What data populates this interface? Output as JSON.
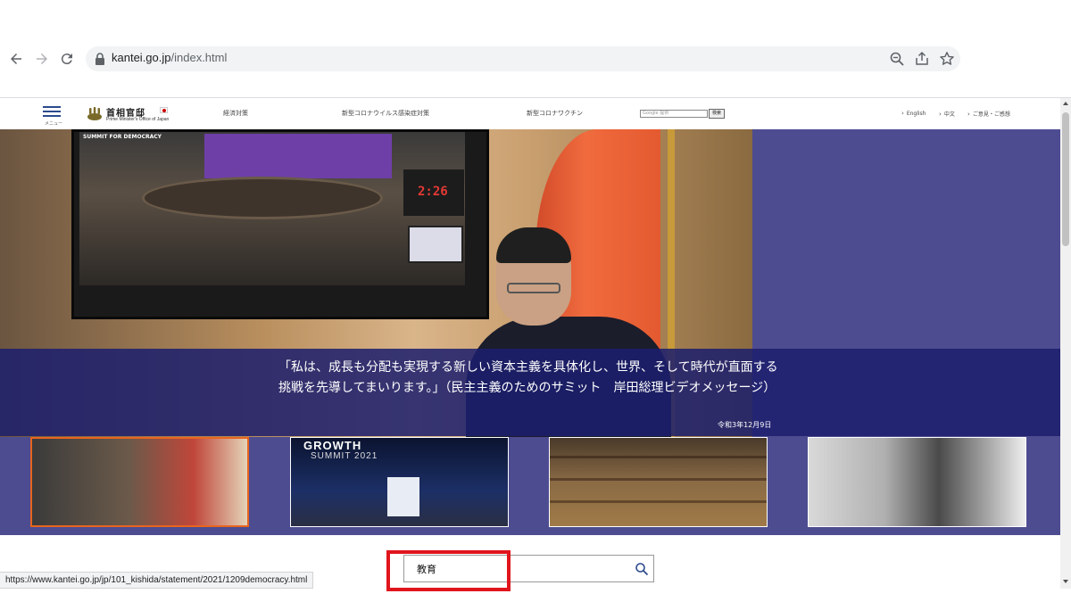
{
  "browser": {
    "url_domain": "kantei.go.jp",
    "url_path": "/index.html",
    "icons": [
      "back-arrow-icon",
      "forward-arrow-icon",
      "reload-icon",
      "lock-icon",
      "zoom-icon",
      "share-icon",
      "bookmark-star-icon"
    ]
  },
  "header": {
    "menu_label": "メニュー",
    "logo_text": "首相官邸",
    "logo_sub": "Prime Minister's Office of Japan",
    "nav": [
      "経済対策",
      "新型コロナウイルス感染症対策",
      "新型コロナワクチン"
    ],
    "search_placeholder": "Google 提供",
    "search_button": "検索",
    "right_links": [
      "English",
      "中文",
      "ご意見・ご感想"
    ]
  },
  "hero": {
    "timer": "2:26",
    "tv_logo": "SUMMIT FOR DEMOCRACY",
    "caption": "「私は、成長も分配も実現する新しい資本主義を具体化し、世界、そして時代が直面する挑戦を先導してまいります。」（民主主義のためのサミット　岸田総理ビデオメッセージ）",
    "date": "令和3年12月9日",
    "thumb2_title": "GROWTH",
    "thumb2_sub": "SUMMIT 2021"
  },
  "search": {
    "value": "教育"
  },
  "status_bar": {
    "url": "https://www.kantei.go.jp/jp/101_kishida/statement/2021/1209democracy.html"
  },
  "colors": {
    "hero_bg": "#4e4c91",
    "caption_band": "#1c1e6e",
    "active_thumb_border": "#e8651e",
    "highlight": "#e0151d"
  }
}
